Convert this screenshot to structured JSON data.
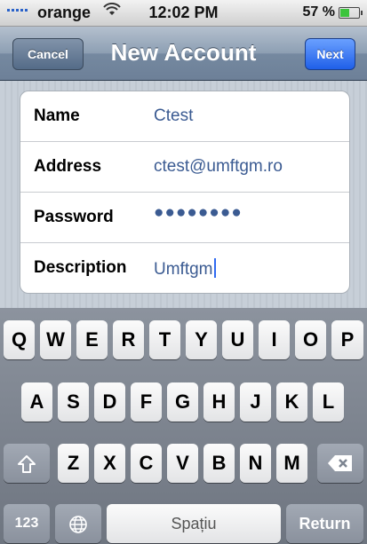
{
  "status_bar": {
    "carrier": "orange",
    "time": "12:02 PM",
    "battery_pct": "57 %",
    "battery_level": 0.57,
    "icons": [
      "signal-icon",
      "wifi-icon",
      "battery-icon"
    ]
  },
  "nav": {
    "title": "New Account",
    "cancel_label": "Cancel",
    "next_label": "Next"
  },
  "form": {
    "fields": [
      {
        "label": "Name",
        "value": "Ctest"
      },
      {
        "label": "Address",
        "value": "ctest@umftgm.ro"
      },
      {
        "label": "Password",
        "value": "●●●●●●●●"
      },
      {
        "label": "Description",
        "value": "Umftgm"
      }
    ]
  },
  "keyboard": {
    "row1": [
      "Q",
      "W",
      "E",
      "R",
      "T",
      "Y",
      "U",
      "I",
      "O",
      "P"
    ],
    "row2": [
      "A",
      "S",
      "D",
      "F",
      "G",
      "H",
      "J",
      "K",
      "L"
    ],
    "row3": [
      "Z",
      "X",
      "C",
      "V",
      "B",
      "N",
      "M"
    ],
    "numbers_label": "123",
    "space_label": "Spațiu",
    "return_label": "Return",
    "icons": [
      "shift-icon",
      "delete-icon",
      "globe-icon"
    ]
  },
  "colors": {
    "accent": "#2f6af2",
    "value_text": "#3b5b92",
    "nav_bar": "#7589a0"
  }
}
